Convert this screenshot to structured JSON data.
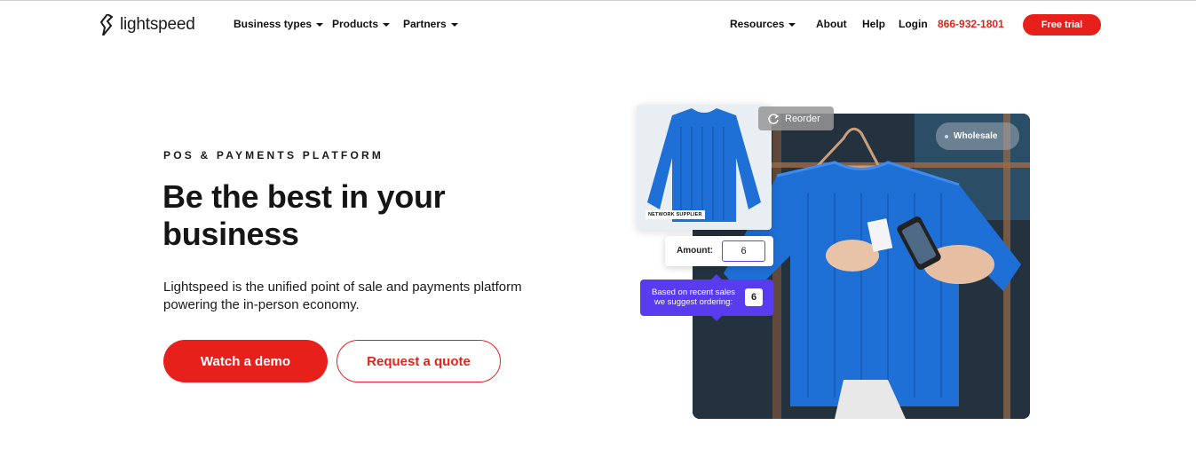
{
  "header": {
    "logo_text": "lightspeed",
    "nav_left": [
      "Business types",
      "Products",
      "Partners"
    ],
    "nav_right": {
      "resources": "Resources",
      "about": "About",
      "help": "Help",
      "login": "Login",
      "phone": "866-932-1801",
      "trial": "Free trial"
    }
  },
  "hero": {
    "eyebrow": "POS & PAYMENTS PLATFORM",
    "headline": "Be the best in your business",
    "description": "Lightspeed is the unified point of sale and payments platform powering the in-person economy.",
    "primary_cta": "Watch a demo",
    "secondary_cta": "Request a quote"
  },
  "visual": {
    "supplier_tag": "NETWORK SUPPLIER",
    "reorder_label": "Reorder",
    "wholesale_label": "Wholesale",
    "amount_label": "Amount:",
    "amount_value": "6",
    "suggestion_text": "Based on recent sales we suggest ordering:",
    "suggestion_value": "6"
  },
  "colors": {
    "brand_red": "#e8201c",
    "suggest_purple": "#5a3cf0",
    "sweater_blue": "#1e6fd6"
  }
}
